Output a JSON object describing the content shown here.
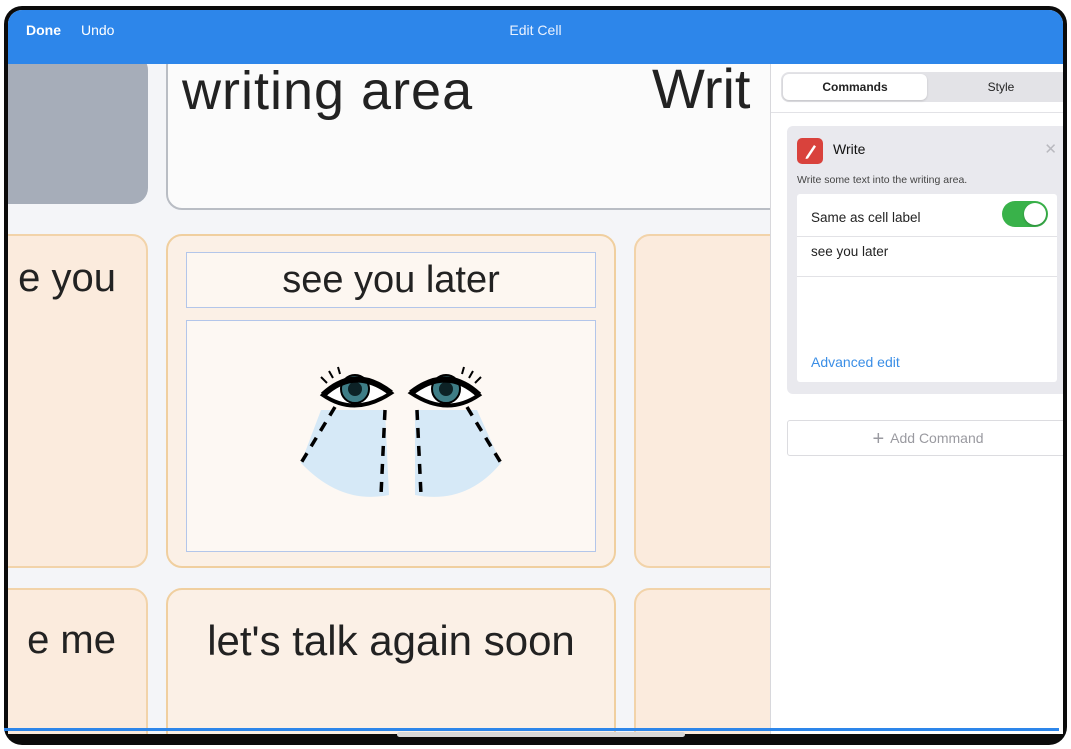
{
  "topbar": {
    "done_label": "Done",
    "undo_label": "Undo",
    "title": "Edit Cell"
  },
  "grid": {
    "writing_area_label": "writing area",
    "write_label_partial": "Writ",
    "see_you_partial": "e you",
    "me_partial": "e me",
    "selected_cell_label": "see you later",
    "selected_cell_image": "crying-eyes-icon",
    "talk_again_label": "let's talk again soon"
  },
  "panel": {
    "tabs": [
      {
        "label": "Commands",
        "active": true
      },
      {
        "label": "Style",
        "active": false
      }
    ],
    "command": {
      "icon": "pencil-icon",
      "icon_color": "#d9423c",
      "title": "Write",
      "description": "Write some text into the writing area.",
      "same_as_label": "Same as cell label",
      "same_as_enabled": true,
      "text_value": "see you later",
      "advanced_edit": "Advanced edit"
    },
    "add_command_label": "Add Command"
  },
  "colors": {
    "accent": "#2d86ea",
    "toggle_on": "#39b24a",
    "link": "#3a8ee6"
  }
}
